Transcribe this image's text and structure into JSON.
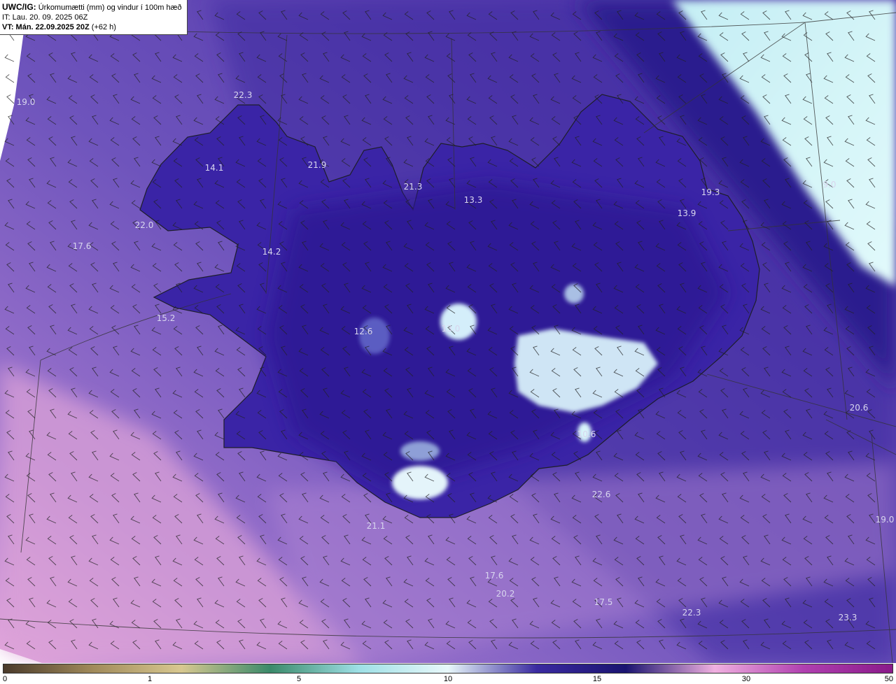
{
  "header": {
    "product_label": "UWC/IG:",
    "title_rest": " Úrkomumætti (mm) og vindur í 100m hæð",
    "init_time": "IT: Lau. 20. 09. 2025 06Z",
    "valid_label": "VT: Mán. 22.09.2025 20Z",
    "lead_time": " (+62 h)"
  },
  "colors": {
    "ocean_violet": "#7a5cc0",
    "deep_indigo": "#2c1d8a",
    "pink_edge": "#d9a0d8",
    "ice_cyan": "#d4f6f8",
    "coastline": "#222222"
  },
  "map_values": [
    "22.3",
    "19.0",
    "14.1",
    "21.9",
    "21.3",
    "13.3",
    "19.3",
    "9.0",
    "13.9",
    "22.0",
    "17.6",
    "14.2",
    "15.2",
    "12.6",
    "13.0",
    "20.6",
    "10.6",
    "22.6",
    "19.0",
    "21.1",
    "17.6",
    "20.2",
    "17.5",
    "22.3",
    "23.3"
  ],
  "colorbar": {
    "ticks": [
      "0",
      "1",
      "5",
      "10",
      "15",
      "30",
      "50"
    ],
    "stops": [
      "#4a3a2a",
      "#a08a5a",
      "#d8c890",
      "#3a8a6a",
      "#9ee0e6",
      "#e8f8fa",
      "#3a2aa0",
      "#1a1470",
      "#f0b0e0",
      "#b040b0",
      "#8a1a8a"
    ]
  }
}
